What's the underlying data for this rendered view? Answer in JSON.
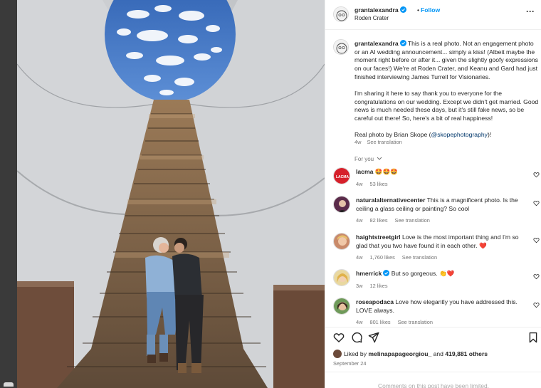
{
  "post": {
    "username": "grantalexandra",
    "follow_label": "Follow",
    "dot": "•",
    "location": "Roden Crater",
    "more_label": "···"
  },
  "caption": {
    "username": "grantalexandra",
    "para1": "This is a real photo. Not an engagement photo or an AI wedding announcement... simply a kiss! (Albeit maybe the moment right before or after it... given the slightly goofy expressions on our faces!) We're at Roden Crater, and Keanu and Gard had just finished interviewing James Turrell for Visionaries.",
    "para2": "I'm sharing it here to say thank you to everyone for the congratulations on our wedding. Except we didn't get married. Good news is much needed these days, but it's still fake news, so be careful out there! So, here's a bit of real happiness!",
    "para3_prefix": "Real photo by Brian Skope (",
    "para3_mention": "@skopephotography",
    "para3_suffix": ")!",
    "age": "4w",
    "see_translation": "See translation"
  },
  "for_you": "For you",
  "comments": [
    {
      "username": "lacma",
      "text": "🤩🤩🤩",
      "age": "4w",
      "likes": "53 likes",
      "translation": ""
    },
    {
      "username": "naturalalternativecenter",
      "text": "This is a magnificent photo. Is the ceiling a glass ceiling or painting? So cool",
      "age": "4w",
      "likes": "82 likes",
      "translation": "See translation"
    },
    {
      "username": "haightstreetgirl",
      "text": "Love is the most important thing and I'm so glad that you two have found it in each other. ❤️",
      "age": "4w",
      "likes": "1,760 likes",
      "translation": "See translation"
    },
    {
      "username": "hmerrick",
      "text": "But so gorgeous. 👏❤️",
      "age": "3w",
      "likes": "12 likes",
      "translation": ""
    },
    {
      "username": "roseapodaca",
      "text": "Love how elegantly you have addressed this. LOVE always.",
      "age": "4w",
      "likes": "801 likes",
      "translation": "See translation"
    }
  ],
  "avatar_labels": {
    "lacma": "LACMA"
  },
  "likes": {
    "prefix": "Liked by ",
    "user": "melinapapageorgiou_",
    "middle": " and ",
    "count": "419,881 others"
  },
  "date": "September 24",
  "comments_limited": "Comments on this post have been limited.",
  "colors": {
    "link": "#0095f6",
    "verified": "#0095f6",
    "lacma_red": "#d6202b",
    "heart": "#ed4956"
  }
}
